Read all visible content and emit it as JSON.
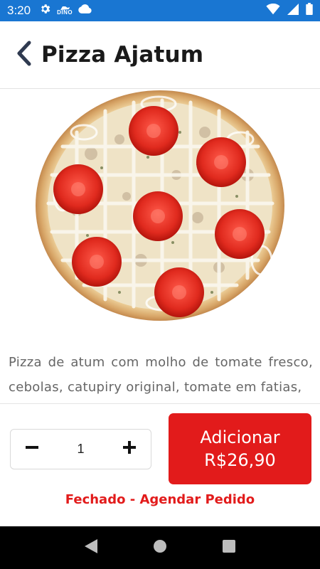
{
  "status_bar": {
    "time": "3:20",
    "icons": [
      "gear-icon",
      "dino-icon",
      "cloud-icon",
      "wifi-icon",
      "signal-icon",
      "battery-icon"
    ],
    "dino_label": "DINO"
  },
  "header": {
    "title": "Pizza Ajatum",
    "back_icon": "chevron-left-icon"
  },
  "product": {
    "image": "pizza-photo",
    "description": "Pizza de atum com molho de tomate fresco, cebolas, catupiry original, tomate em fatias,"
  },
  "order": {
    "quantity": "1",
    "decrement_icon": "minus-icon",
    "increment_icon": "plus-icon",
    "add_label": "Adicionar",
    "price": "R$26,90"
  },
  "store_status": "Fechado - Agendar Pedido",
  "colors": {
    "status_bar": "#1976d2",
    "accent_red": "#e21b1b",
    "nav_bar": "#000000"
  },
  "nav_bar": {
    "icons": [
      "back-triangle-icon",
      "home-circle-icon",
      "recents-square-icon"
    ]
  }
}
